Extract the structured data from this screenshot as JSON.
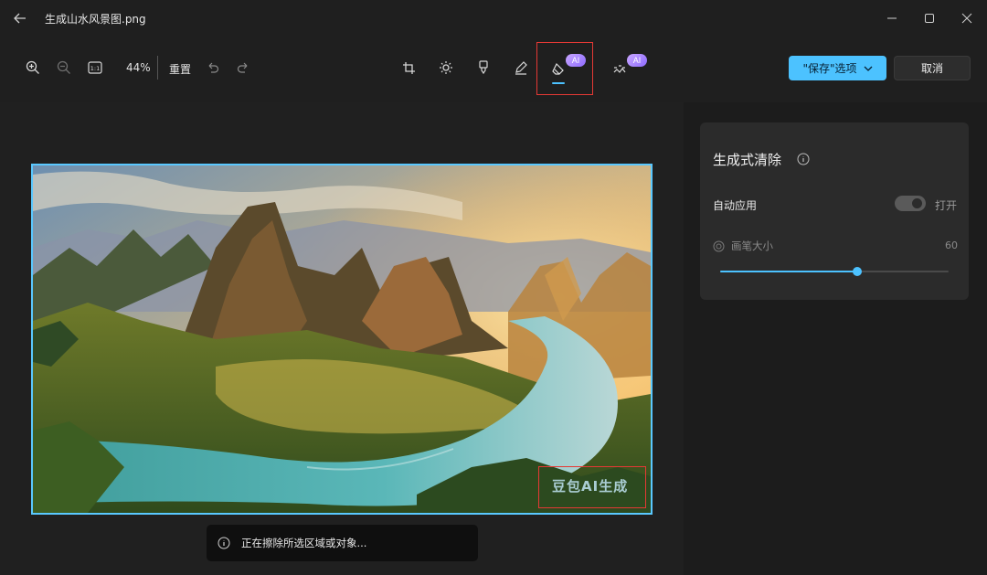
{
  "window": {
    "title": "生成山水风景图.png"
  },
  "toolbar": {
    "zoom": "44%",
    "reset_label": "重置",
    "ai_badge_1": "AI",
    "ai_badge_2": "AI",
    "save_label": "\"保存\"选项",
    "cancel_label": "取消"
  },
  "panel": {
    "title": "生成式清除",
    "auto_apply_label": "自动应用",
    "auto_apply_state": "打开",
    "brush_label": "画笔大小",
    "brush_value": "60",
    "brush_fraction": 0.6
  },
  "image": {
    "watermark": "豆包AI生成"
  },
  "toast": {
    "message": "正在擦除所选区域或对象..."
  },
  "colors": {
    "accent": "#4cc2ff",
    "highlight": "#e53935"
  }
}
